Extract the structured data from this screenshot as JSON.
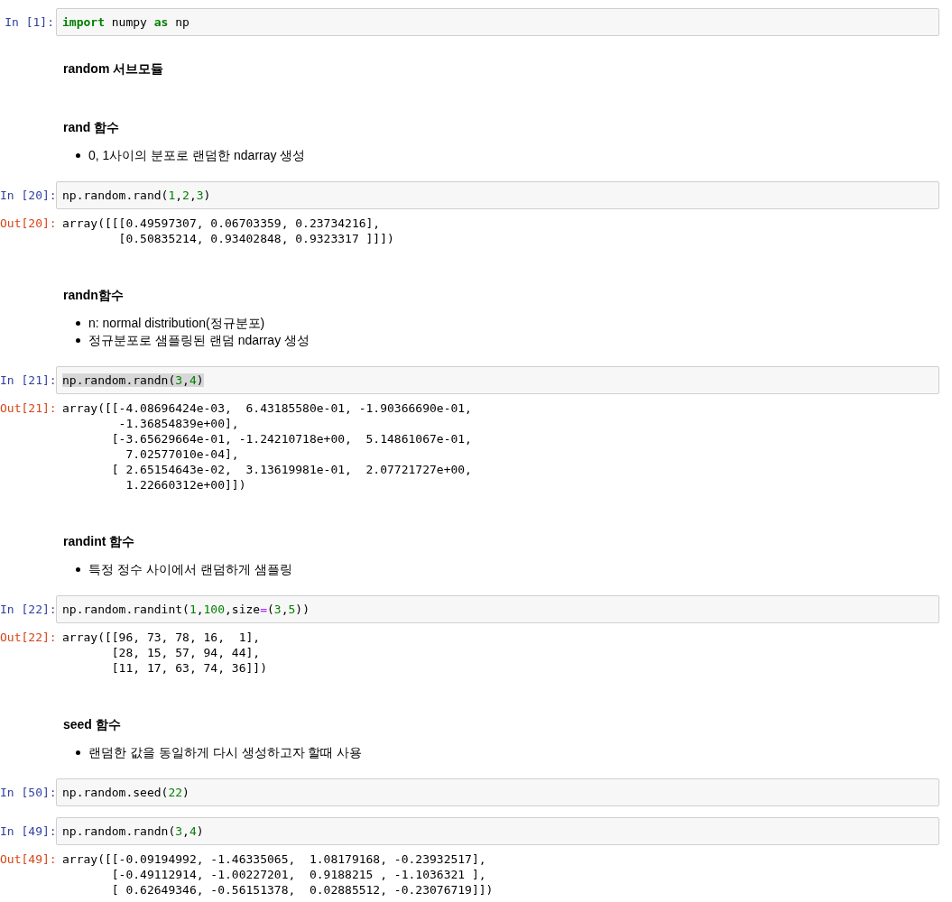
{
  "cells": [
    {
      "kind": "code",
      "prompt": "In [1]:",
      "highlighted": false,
      "code": [
        {
          "text": "import",
          "kind": "keyword"
        },
        {
          "text": " numpy ",
          "kind": "plain"
        },
        {
          "text": "as",
          "kind": "keyword"
        },
        {
          "text": " np",
          "kind": "plain"
        }
      ]
    },
    {
      "kind": "markdown",
      "heading": "random 서브모듈"
    },
    {
      "kind": "markdown",
      "heading": "rand 함수",
      "bullets": [
        "0, 1사이의 분포로 랜덤한 ndarray 생성"
      ]
    },
    {
      "kind": "code",
      "prompt": "In [20]:",
      "highlighted": false,
      "code": [
        {
          "text": "np.random.rand(",
          "kind": "plain"
        },
        {
          "text": "1",
          "kind": "number"
        },
        {
          "text": ",",
          "kind": "plain"
        },
        {
          "text": "2",
          "kind": "number"
        },
        {
          "text": ",",
          "kind": "plain"
        },
        {
          "text": "3",
          "kind": "number"
        },
        {
          "text": ")",
          "kind": "plain"
        }
      ],
      "output_prompt": "Out[20]:",
      "output": "array([[[0.49597307, 0.06703359, 0.23734216],\n        [0.50835214, 0.93402848, 0.9323317 ]]])"
    },
    {
      "kind": "markdown",
      "heading": "randn함수",
      "bullets": [
        "n: normal distribution(정규분포)",
        "정규분포로 샘플링된 랜덤 ndarray 생성"
      ]
    },
    {
      "kind": "code",
      "prompt": "In [21]:",
      "highlighted": true,
      "code": [
        {
          "text": "np.random.randn(",
          "kind": "plain"
        },
        {
          "text": "3",
          "kind": "number"
        },
        {
          "text": ",",
          "kind": "plain"
        },
        {
          "text": "4",
          "kind": "number"
        },
        {
          "text": ")",
          "kind": "plain"
        }
      ],
      "output_prompt": "Out[21]:",
      "output": "array([[-4.08696424e-03,  6.43185580e-01, -1.90366690e-01,\n        -1.36854839e+00],\n       [-3.65629664e-01, -1.24210718e+00,  5.14861067e-01,\n         7.02577010e-04],\n       [ 2.65154643e-02,  3.13619981e-01,  2.07721727e+00,\n         1.22660312e+00]])"
    },
    {
      "kind": "markdown",
      "heading": "randint 함수",
      "bullets": [
        "특정 정수 사이에서 랜덤하게 샘플링"
      ]
    },
    {
      "kind": "code",
      "prompt": "In [22]:",
      "highlighted": false,
      "code": [
        {
          "text": "np.random.randint(",
          "kind": "plain"
        },
        {
          "text": "1",
          "kind": "number"
        },
        {
          "text": ",",
          "kind": "plain"
        },
        {
          "text": "100",
          "kind": "number"
        },
        {
          "text": ",size",
          "kind": "plain"
        },
        {
          "text": "=",
          "kind": "operator"
        },
        {
          "text": "(",
          "kind": "plain"
        },
        {
          "text": "3",
          "kind": "number"
        },
        {
          "text": ",",
          "kind": "plain"
        },
        {
          "text": "5",
          "kind": "number"
        },
        {
          "text": "))",
          "kind": "plain"
        }
      ],
      "output_prompt": "Out[22]:",
      "output": "array([[96, 73, 78, 16,  1],\n       [28, 15, 57, 94, 44],\n       [11, 17, 63, 74, 36]])"
    },
    {
      "kind": "markdown",
      "heading": "seed 함수",
      "bullets": [
        "랜덤한 값을 동일하게 다시 생성하고자 할때 사용"
      ]
    },
    {
      "kind": "code",
      "prompt": "In [50]:",
      "highlighted": false,
      "code": [
        {
          "text": "np.random.seed(",
          "kind": "plain"
        },
        {
          "text": "22",
          "kind": "number"
        },
        {
          "text": ")",
          "kind": "plain"
        }
      ]
    },
    {
      "kind": "code",
      "prompt": "In [49]:",
      "highlighted": false,
      "code": [
        {
          "text": "np.random.randn(",
          "kind": "plain"
        },
        {
          "text": "3",
          "kind": "number"
        },
        {
          "text": ",",
          "kind": "plain"
        },
        {
          "text": "4",
          "kind": "number"
        },
        {
          "text": ")",
          "kind": "plain"
        }
      ],
      "output_prompt": "Out[49]:",
      "output": "array([[-0.09194992, -1.46335065,  1.08179168, -0.23932517],\n       [-0.49112914, -1.00227201,  0.9188215 , -1.1036321 ],\n       [ 0.62649346, -0.56151378,  0.02885512, -0.23076719]])"
    }
  ]
}
